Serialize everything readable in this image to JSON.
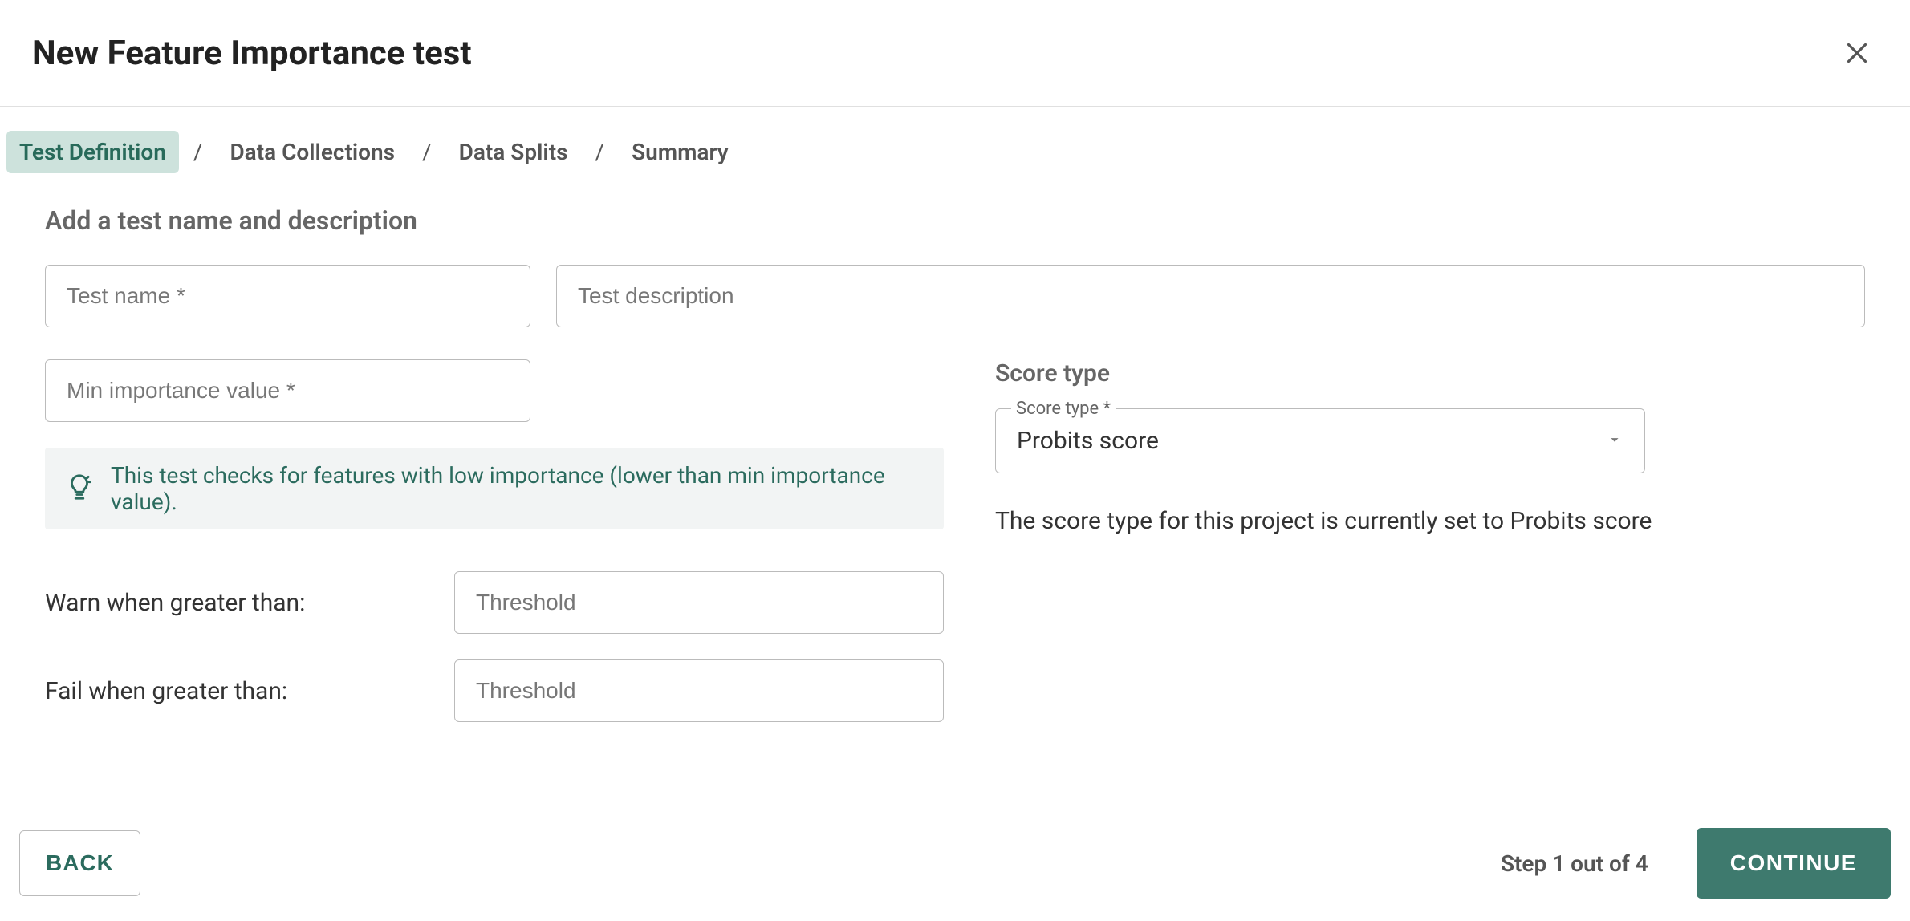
{
  "header": {
    "title": "New Feature Importance test"
  },
  "breadcrumb": {
    "items": [
      {
        "label": "Test Definition",
        "active": true
      },
      {
        "label": "Data Collections",
        "active": false
      },
      {
        "label": "Data Splits",
        "active": false
      },
      {
        "label": "Summary",
        "active": false
      }
    ]
  },
  "form": {
    "section_heading": "Add a test name and description",
    "test_name_placeholder": "Test name *",
    "test_description_placeholder": "Test description",
    "min_importance_placeholder": "Min importance value *",
    "hint_text": "This test checks for features with low importance (lower than min importance value).",
    "warn_label": "Warn when greater than:",
    "fail_label": "Fail when greater than:",
    "threshold_placeholder": "Threshold"
  },
  "score": {
    "heading": "Score type",
    "select_legend": "Score type *",
    "selected": "Probits score",
    "message": "The score type for this project is currently set to Probits score"
  },
  "footer": {
    "back_label": "BACK",
    "step_text": "Step 1 out of 4",
    "continue_label": "CONTINUE"
  }
}
